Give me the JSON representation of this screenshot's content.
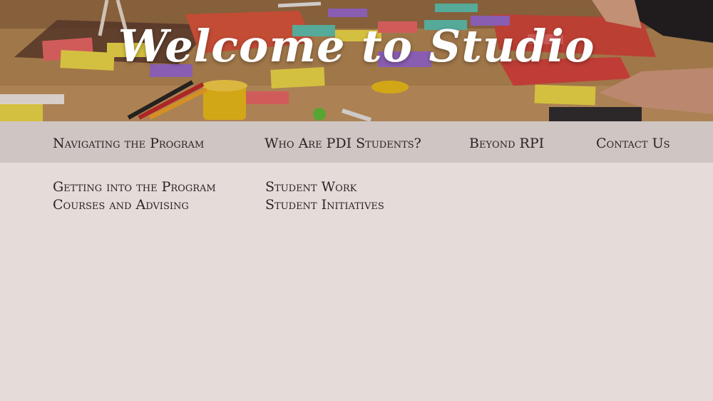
{
  "hero": {
    "title": "Welcome to Studio",
    "image_icon": "studio-workshop-photo"
  },
  "nav": {
    "items": [
      {
        "label": "Navigating the Program"
      },
      {
        "label": "Who Are PDI Students?"
      },
      {
        "label": "Beyond RPI"
      },
      {
        "label": "Contact Us"
      }
    ]
  },
  "submenus": {
    "program": [
      "Getting into the Program",
      "Courses and Advising"
    ],
    "students": [
      "Student Work",
      "Student Initiatives"
    ]
  },
  "colors": {
    "nav_bg": "#cfc5c3",
    "page_bg": "#e5dcda",
    "text": "#2a2422"
  }
}
